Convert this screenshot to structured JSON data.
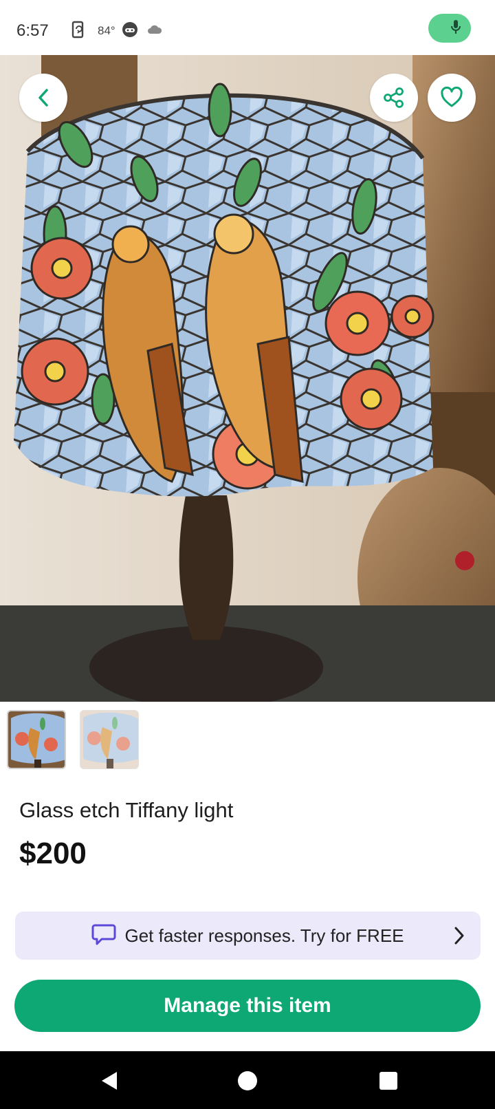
{
  "status_bar": {
    "time": "6:57",
    "temperature": "84°",
    "icons": [
      "screen-rotate-icon",
      "game-controller-icon",
      "cloud-icon",
      "microphone-icon"
    ],
    "mic_color": "#5bd08f"
  },
  "hero": {
    "icons": [
      "back-chevron-icon",
      "share-icon",
      "heart-icon"
    ],
    "accent": "#0ea874"
  },
  "thumbnails": [
    {
      "name": "thumbnail-1",
      "selected": true
    },
    {
      "name": "thumbnail-2",
      "selected": false
    }
  ],
  "item": {
    "title": "Glass etch Tiffany light",
    "price": "$200"
  },
  "promo": {
    "text": "Get faster responses. Try for FREE",
    "icon": "chat-bubble-icon",
    "background": "#ece9fb"
  },
  "actions": {
    "manage_label": "Manage this item",
    "manage_color": "#0ea874"
  },
  "nav": {
    "icons": [
      "nav-back-icon",
      "nav-home-icon",
      "nav-recents-icon"
    ]
  }
}
